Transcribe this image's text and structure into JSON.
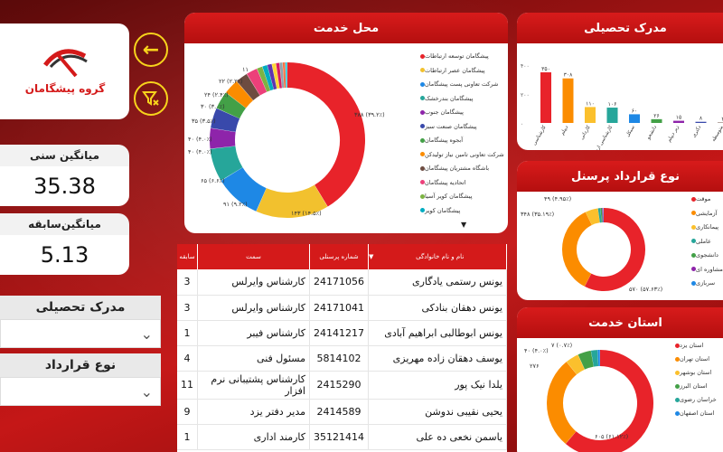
{
  "logo": {
    "brand_text": "گروه پیشگامان"
  },
  "nav": {
    "back_icon": "arrow-left-icon",
    "clear_filter_icon": "filter-clear-icon"
  },
  "kpis": {
    "avg_age": {
      "label": "میانگین سنی",
      "value": "35.38"
    },
    "avg_tenure": {
      "label": "میانگین‌سابقه",
      "value": "5.13"
    }
  },
  "filters": {
    "education": {
      "label": "مدرک تحصیلی"
    },
    "contract": {
      "label": "نوع قرارداد"
    }
  },
  "service_location": {
    "title": "محل خدمت",
    "legend": [
      "پیشگامان توسعه ارتباطات",
      "پیشگامان عصر ارتباطات",
      "شرکت تعاونی پست پیشگامان",
      "پیشگامان بندرخشک",
      "پیشگامان جنوب",
      "پیشگامان صنعت سبز",
      "آبجوه پیشگامان",
      "شرکت تعاونی تامین نیاز تولیدکن",
      "باشگاه مشتریان پیشگامان",
      "اتحادیه پیشگامان",
      "پیشگامان کویر آسیا",
      "پیشگامان کویر"
    ],
    "callouts": [
      "۳۸۸ (۳۹.۲٪)",
      "۱۴۳ (۱۴.۵٪)",
      "۹۱ (۹.۲٪)",
      "۶۵ (۶.۶٪)",
      "۴۰ (۴.۰٪)",
      "۴۰ (۴.۰٪)",
      "۳۵ (۳.۵٪)",
      "۳۰ (۳.۰٪)",
      "۲۴ (۲.۴٪)",
      "۲۲ (۲.۲٪)",
      "۱۱"
    ],
    "colors": [
      "#e8232a",
      "#f2c12e",
      "#1e88e5",
      "#26a69a",
      "#8e24aa",
      "#3949ab",
      "#43a047",
      "#fb8c00",
      "#6d4c41",
      "#ec407a",
      "#7cb342",
      "#00acc1",
      "#5e35b1",
      "#fdd835",
      "#d81b60",
      "#90a4ae",
      "#ff7043",
      "#26c6da"
    ]
  },
  "education_chart": {
    "title": "مدرک تحصیلی",
    "y_ticks": [
      "۴۰۰",
      "۲۰۰",
      "۰"
    ],
    "categories": [
      "کارشناسی",
      "دیپلم",
      "کاردانی",
      "کارشناسی ارشد",
      "سیکل",
      "دانشجو",
      "زیر دیپلم",
      "دکتری",
      "متوسطه"
    ],
    "values": [
      350,
      308,
      110,
      106,
      60,
      26,
      15,
      8,
      3
    ],
    "value_labels": [
      "۳۵۰",
      "۳۰۸",
      "۱۱۰",
      "۱۰۶",
      "۶۰",
      "۲۶",
      "۱۵",
      "۸",
      "۳"
    ],
    "colors": [
      "#e8232a",
      "#fb8c00",
      "#fbc02d",
      "#26a69a",
      "#1e88e5",
      "#43a047",
      "#8e24aa",
      "#3949ab",
      "#6d4c41"
    ]
  },
  "contract_type": {
    "title": "نوع قرارداد پرسنل",
    "legend": [
      "موقت",
      "آزمایشی",
      "پیمانکاری",
      "عاملی",
      "دانشجوی",
      "مشاوره ای",
      "سربازی"
    ],
    "callouts": [
      "۵۷۰ (۵۷.۶۳٪)",
      "۳۴۸ (۳۵.۱۹٪)",
      "۴۹ (۴.۹۵٪)"
    ],
    "values": [
      570,
      348,
      49,
      10,
      6,
      4,
      2
    ],
    "colors": [
      "#e8232a",
      "#fb8c00",
      "#fbc02d",
      "#26a69a",
      "#43a047",
      "#8e24aa",
      "#1e88e5"
    ]
  },
  "service_province": {
    "title": "استان خدمت",
    "legend": [
      "استان یزد",
      "استان تهران",
      "استان بوشهر",
      "استان البرز",
      "خراسان رضوی",
      "استان اصفهان"
    ],
    "callouts": [
      "۶۰۵ (۶۱.۱۲٪)",
      "۲۷۶",
      "۴۰ (۴.۰٪)",
      "۷ (۰.۷٪)"
    ],
    "values": [
      605,
      276,
      40,
      40,
      20,
      7
    ],
    "colors": [
      "#e8232a",
      "#fb8c00",
      "#fbc02d",
      "#43a047",
      "#26a69a",
      "#1e88e5"
    ]
  },
  "table": {
    "headers": [
      "نام و نام خانوادگی",
      "شماره پرسنلی",
      "سمت",
      "سابقه"
    ],
    "rows": [
      {
        "name": "یونس رستمی یادگاری",
        "id": "24171056",
        "role": "کارشناس وایرلس",
        "tenure": "3"
      },
      {
        "name": "یونس دهقان بنادکی",
        "id": "24171041",
        "role": "کارشناس وایرلس",
        "tenure": "3"
      },
      {
        "name": "یونس ابوطالبی ابراهیم آبادی",
        "id": "24141217",
        "role": "کارشناس فیبر",
        "tenure": "1"
      },
      {
        "name": "یوسف دهقان زاده مهریزی",
        "id": "5814102",
        "role": "مسئول فنی",
        "tenure": "4"
      },
      {
        "name": "یلدا نیک پور",
        "id": "2415290",
        "role": "کارشناس پشتیبانی نرم افزار",
        "tenure": "11"
      },
      {
        "name": "یحیی نقیبی ندوشن",
        "id": "2414589",
        "role": "مدیر دفتر یزد",
        "tenure": "9"
      },
      {
        "name": "یاسمن نخعی ده علی",
        "id": "35121414",
        "role": "کارمند اداری",
        "tenure": "1"
      }
    ]
  }
}
